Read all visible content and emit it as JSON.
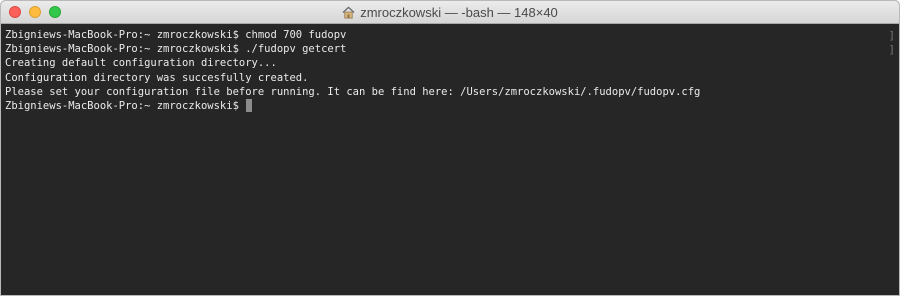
{
  "window": {
    "title": "zmroczkowski — -bash — 148×40",
    "title_icon": "home-folder-icon"
  },
  "colors": {
    "terminal_bg": "#262626",
    "text": "#eaeaea",
    "close": "#fc605b",
    "minimize": "#fdbc40",
    "zoom": "#34c84a"
  },
  "terminal": {
    "lines": [
      "Zbigniews-MacBook-Pro:~ zmroczkowski$ chmod 700 fudopv",
      "Zbigniews-MacBook-Pro:~ zmroczkowski$ ./fudopv getcert",
      "Creating default configuration directory...",
      "Configuration directory was succesfully created.",
      "Please set your configuration file before running. It can be find here: /Users/zmroczkowski/.fudopv/fudopv.cfg",
      "Zbigniews-MacBook-Pro:~ zmroczkowski$ "
    ],
    "bracket_marks": [
      "]",
      "]"
    ]
  }
}
